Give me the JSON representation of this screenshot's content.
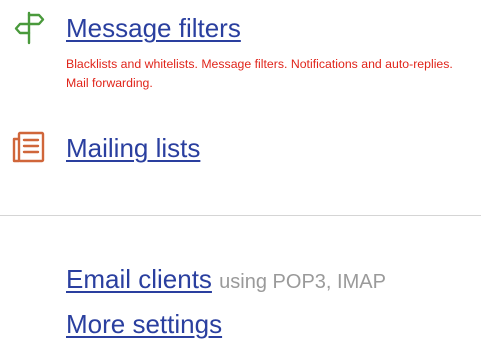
{
  "sections": {
    "message_filters": {
      "icon": "signpost-icon",
      "title": "Message filters",
      "description": "Blacklists and whitelists. Message filters. Notifications and auto-replies. Mail forwarding."
    },
    "mailing_lists": {
      "icon": "document-list-icon",
      "title": "Mailing lists"
    }
  },
  "links": {
    "email_clients": {
      "label": "Email clients",
      "suffix": "using POP3, IMAP"
    },
    "more_settings": {
      "label": "More settings"
    }
  },
  "colors": {
    "link": "#2a3f9f",
    "description": "#e0251b",
    "signpost_icon": "#4a9a3c",
    "list_icon": "#d0663a",
    "muted_text": "#9a9a9a",
    "divider": "#d5d5d5"
  }
}
